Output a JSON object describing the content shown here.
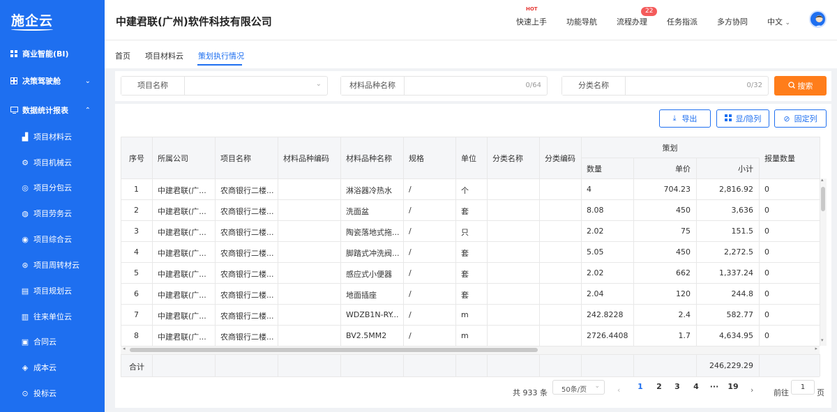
{
  "sidebar": {
    "logo": "施企云",
    "items": [
      {
        "label": "商业智能(BI)",
        "icon": "grid-icon"
      },
      {
        "label": "决策驾驶舱",
        "icon": "dashboard-icon",
        "chevron": "⌄"
      },
      {
        "label": "数据统计报表",
        "icon": "report-icon",
        "chevron": "⌃"
      },
      {
        "label": "项目材料云",
        "icon": "material-icon"
      },
      {
        "label": "项目机械云",
        "icon": "gear-icon"
      },
      {
        "label": "项目分包云",
        "icon": "subcontract-icon"
      },
      {
        "label": "项目劳务云",
        "icon": "labor-icon"
      },
      {
        "label": "项目综合云",
        "icon": "integrated-icon"
      },
      {
        "label": "项目周转材云",
        "icon": "turnover-icon"
      },
      {
        "label": "项目规划云",
        "icon": "plan-icon"
      },
      {
        "label": "往来单位云",
        "icon": "building-icon"
      },
      {
        "label": "合同云",
        "icon": "contract-icon"
      },
      {
        "label": "成本云",
        "icon": "cost-icon"
      },
      {
        "label": "投标云",
        "icon": "bid-icon"
      }
    ]
  },
  "header": {
    "company": "中建君联(广州)软件科技有限公司",
    "hot": "HOT",
    "links": [
      "快速上手",
      "功能导航",
      "流程办理",
      "任务指派",
      "多方协同"
    ],
    "badge": "22",
    "lang": "中文"
  },
  "tabs": [
    "首页",
    "项目材料云",
    "策划执行情况"
  ],
  "filter": {
    "project_label": "项目名称",
    "material_label": "材料品种名称",
    "material_count": "0/64",
    "category_label": "分类名称",
    "category_count": "0/32",
    "search": "搜索"
  },
  "toolbar": {
    "export": "导出",
    "toggle_cols": "显/隐列",
    "fix_cols": "固定列"
  },
  "table": {
    "headers": [
      "序号",
      "所属公司",
      "项目名称",
      "材料品种编码",
      "材料品种名称",
      "规格",
      "单位",
      "分类名称",
      "分类编码"
    ],
    "group_header": "策划",
    "sub_headers": [
      "数量",
      "单价",
      "小计"
    ],
    "last_header": "报量数量",
    "rows": [
      [
        "1",
        "中建君联(广...",
        "农商银行二楼...",
        "",
        "淋浴器冷热水",
        "/",
        "个",
        "",
        "",
        "4",
        "704.23",
        "2,816.92",
        "0"
      ],
      [
        "2",
        "中建君联(广...",
        "农商银行二楼...",
        "",
        "洗面盆",
        "/",
        "套",
        "",
        "",
        "8.08",
        "450",
        "3,636",
        "0"
      ],
      [
        "3",
        "中建君联(广...",
        "农商银行二楼...",
        "",
        "陶瓷落地式拖...",
        "/",
        "只",
        "",
        "",
        "2.02",
        "75",
        "151.5",
        "0"
      ],
      [
        "4",
        "中建君联(广...",
        "农商银行二楼...",
        "",
        "脚踏式冲洗阀...",
        "/",
        "套",
        "",
        "",
        "5.05",
        "450",
        "2,272.5",
        "0"
      ],
      [
        "5",
        "中建君联(广...",
        "农商银行二楼...",
        "",
        "感应式小便器",
        "/",
        "套",
        "",
        "",
        "2.02",
        "662",
        "1,337.24",
        "0"
      ],
      [
        "6",
        "中建君联(广...",
        "农商银行二楼...",
        "",
        "地面插座",
        "/",
        "套",
        "",
        "",
        "2.04",
        "120",
        "244.8",
        "0"
      ],
      [
        "7",
        "中建君联(广...",
        "农商银行二楼...",
        "",
        "WDZB1N-RY...",
        "/",
        "m",
        "",
        "",
        "242.8228",
        "2.4",
        "582.77",
        "0"
      ],
      [
        "8",
        "中建君联(广...",
        "农商银行二楼...",
        "",
        "BV2.5MM2",
        "/",
        "m",
        "",
        "",
        "2726.4408",
        "1.7",
        "4,634.95",
        "0"
      ]
    ],
    "total_label": "合计",
    "total_value": "246,229.29"
  },
  "pagination": {
    "total": "共 933 条",
    "page_size": "50条/页",
    "pages": [
      "1",
      "2",
      "3",
      "4",
      "19"
    ],
    "ellipsis": "···",
    "goto_label": "前往",
    "goto_value": "1",
    "page_suffix": "页"
  },
  "colors": {
    "primary": "#1e6ff0",
    "search": "#ff7d1a",
    "badge": "#f45b5b"
  }
}
